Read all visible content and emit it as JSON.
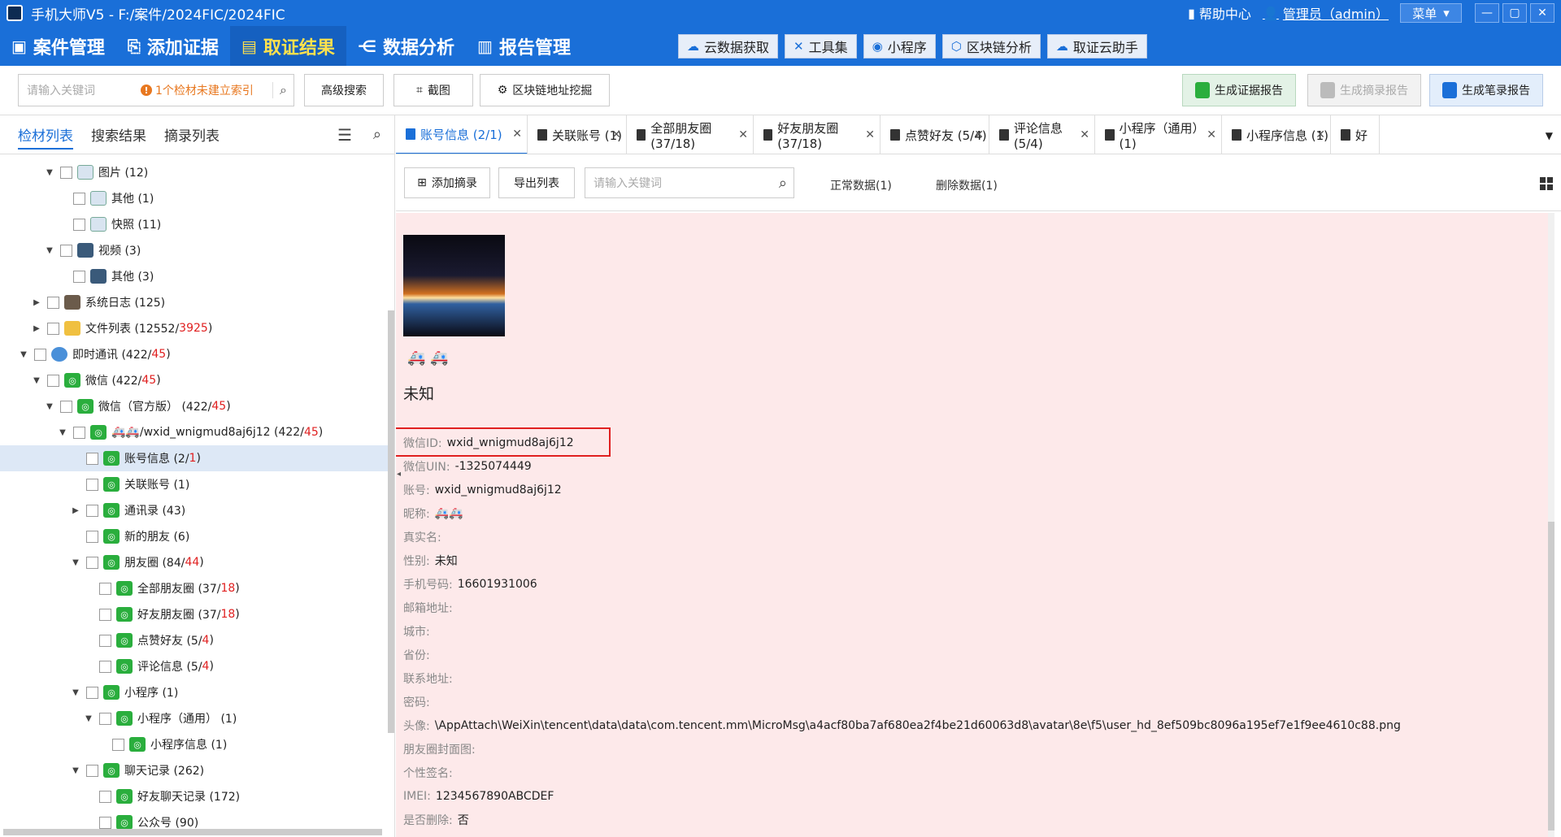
{
  "titlebar": {
    "title": "手机大师V5 - F:/案件/2024FIC/2024FIC",
    "help": "帮助中心",
    "user": "管理员（admin）",
    "menu": "菜单"
  },
  "nav": {
    "items": [
      "案件管理",
      "添加证据",
      "取证结果",
      "数据分析",
      "报告管理"
    ],
    "active": "取证结果",
    "tools": [
      "云数据获取",
      "工具集",
      "小程序",
      "区块链分析",
      "取证云助手"
    ]
  },
  "toolbar": {
    "search_placeholder": "请输入关键词",
    "warning": "1个检材未建立索引",
    "advanced_search": "高级搜索",
    "screenshot": "截图",
    "blockchain": "区块链地址挖掘",
    "gen_evidence": "生成证据报告",
    "gen_summary": "生成摘录报告",
    "gen_notes": "生成笔录报告"
  },
  "left": {
    "tabs": [
      "检材列表",
      "搜索结果",
      "摘录列表"
    ],
    "tree": [
      {
        "indent": 1,
        "expand": "open",
        "icon": "img",
        "label": "图片 (12)"
      },
      {
        "indent": 2,
        "expand": "",
        "icon": "img",
        "label": "其他 (1)"
      },
      {
        "indent": 2,
        "expand": "",
        "icon": "img",
        "label": "快照 (11)"
      },
      {
        "indent": 1,
        "expand": "open",
        "icon": "vid",
        "label": "视频 (3)"
      },
      {
        "indent": 2,
        "expand": "",
        "icon": "vid",
        "label": "其他 (3)"
      },
      {
        "indent": 0,
        "expand": "closed",
        "icon": "log",
        "label": "系统日志 (125)"
      },
      {
        "indent": 0,
        "expand": "closed",
        "icon": "folder",
        "label": "文件列表 (12552/",
        "red": "3925",
        "tail": ")"
      },
      {
        "indent": -1,
        "expand": "open",
        "icon": "chat",
        "label": "即时通讯 (422/",
        "red": "45",
        "tail": ")"
      },
      {
        "indent": 0,
        "expand": "open",
        "icon": "wx",
        "label": "微信 (422/",
        "red": "45",
        "tail": ")"
      },
      {
        "indent": 1,
        "expand": "open",
        "icon": "wx",
        "label": "微信（官方版） (422/",
        "red": "45",
        "tail": ")"
      },
      {
        "indent": 2,
        "expand": "open",
        "icon": "wx",
        "label": "🚑🚑/wxid_wnigmud8aj6j12 (422/",
        "red": "45",
        "tail": ")"
      },
      {
        "indent": 3,
        "expand": "",
        "icon": "wx",
        "label": "账号信息 (2/",
        "red": "1",
        "tail": ")",
        "selected": true
      },
      {
        "indent": 3,
        "expand": "",
        "icon": "wx",
        "label": "关联账号 (1)"
      },
      {
        "indent": 3,
        "expand": "closed",
        "icon": "wx",
        "label": "通讯录 (43)"
      },
      {
        "indent": 3,
        "expand": "",
        "icon": "wx",
        "label": "新的朋友 (6)"
      },
      {
        "indent": 3,
        "expand": "open",
        "icon": "wx",
        "label": "朋友圈 (84/",
        "red": "44",
        "tail": ")"
      },
      {
        "indent": 4,
        "expand": "",
        "icon": "wx",
        "label": "全部朋友圈 (37/",
        "red": "18",
        "tail": ")"
      },
      {
        "indent": 4,
        "expand": "",
        "icon": "wx",
        "label": "好友朋友圈 (37/",
        "red": "18",
        "tail": ")"
      },
      {
        "indent": 4,
        "expand": "",
        "icon": "wx",
        "label": "点赞好友 (5/",
        "red": "4",
        "tail": ")"
      },
      {
        "indent": 4,
        "expand": "",
        "icon": "wx",
        "label": "评论信息 (5/",
        "red": "4",
        "tail": ")"
      },
      {
        "indent": 3,
        "expand": "open",
        "icon": "wx",
        "label": "小程序 (1)"
      },
      {
        "indent": 4,
        "expand": "open",
        "icon": "wx",
        "label": "小程序（通用） (1)"
      },
      {
        "indent": 5,
        "expand": "",
        "icon": "wx",
        "label": "小程序信息 (1)"
      },
      {
        "indent": 3,
        "expand": "open",
        "icon": "wx",
        "label": "聊天记录 (262)"
      },
      {
        "indent": 4,
        "expand": "",
        "icon": "wx",
        "label": "好友聊天记录 (172)"
      },
      {
        "indent": 4,
        "expand": "",
        "icon": "wx",
        "label": "公众号 (90)"
      }
    ]
  },
  "rtabs": [
    {
      "label": "账号信息 (2/1)",
      "active": true
    },
    {
      "label": "关联账号 (1)"
    },
    {
      "label": "全部朋友圈 (37/18)"
    },
    {
      "label": "好友朋友圈 (37/18)"
    },
    {
      "label": "点赞好友 (5/4)"
    },
    {
      "label": "评论信息 (5/4)"
    },
    {
      "label": "小程序（通用） (1)"
    },
    {
      "label": "小程序信息 (1)"
    },
    {
      "label": "好"
    }
  ],
  "subbar": {
    "add_summary": "添加摘录",
    "export": "导出列表",
    "search_placeholder": "请输入关键词",
    "normal": "正常数据(1)",
    "deleted": "删除数据(1)"
  },
  "detail": {
    "nickname_emoji": "🚑 🚑",
    "big_name": "未知",
    "fields": [
      {
        "k": "微信ID:",
        "v": "wxid_wnigmud8aj6j12"
      },
      {
        "k": "微信UIN:",
        "v": "-1325074449"
      },
      {
        "k": "账号:",
        "v": "wxid_wnigmud8aj6j12"
      },
      {
        "k": "昵称:",
        "v": "🚑🚑"
      },
      {
        "k": "真实名:",
        "v": ""
      },
      {
        "k": "性别:",
        "v": "未知"
      },
      {
        "k": "手机号码:",
        "v": "16601931006"
      },
      {
        "k": "邮箱地址:",
        "v": ""
      },
      {
        "k": "城市:",
        "v": ""
      },
      {
        "k": "省份:",
        "v": ""
      },
      {
        "k": "联系地址:",
        "v": ""
      },
      {
        "k": "密码:",
        "v": ""
      },
      {
        "k": "头像:",
        "v": "\\AppAttach\\WeiXin\\tencent\\data\\data\\com.tencent.mm\\MicroMsg\\a4acf80ba7af680ea2f4be21d60063d8\\avatar\\8e\\f5\\user_hd_8ef509bc8096a195ef7e1f9ee4610c88.png"
      },
      {
        "k": "朋友圈封面图:",
        "v": ""
      },
      {
        "k": "个性签名:",
        "v": ""
      },
      {
        "k": "IMEI:",
        "v": "1234567890ABCDEF"
      },
      {
        "k": "是否删除:",
        "v": "否"
      }
    ]
  }
}
